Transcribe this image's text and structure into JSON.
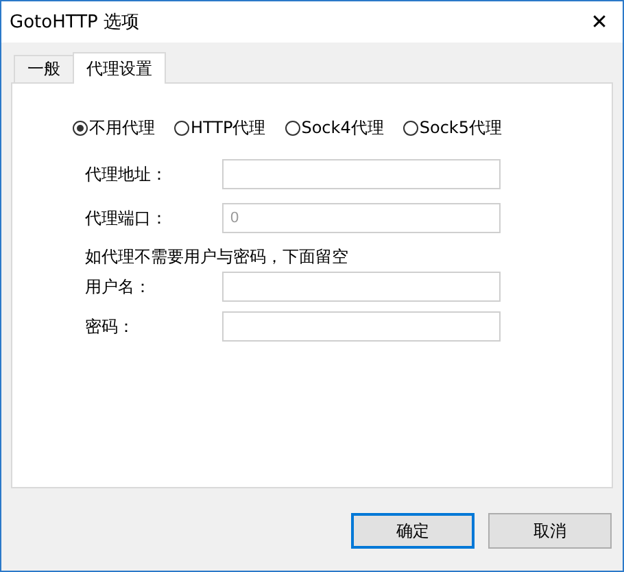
{
  "window": {
    "title": "GotoHTTP 选项",
    "close": "✕"
  },
  "tabs": [
    {
      "label": "一般",
      "selected": false
    },
    {
      "label": "代理设置",
      "selected": true
    }
  ],
  "proxy_types": [
    {
      "label": "不用代理",
      "selected": true
    },
    {
      "label": "HTTP代理",
      "selected": false
    },
    {
      "label": "Sock4代理",
      "selected": false
    },
    {
      "label": "Sock5代理",
      "selected": false
    }
  ],
  "server_fields": [
    {
      "label": "代理地址："
    },
    {
      "label": "代理端口：",
      "placeholder": "0"
    }
  ],
  "note": "如代理不需要用户与密码，下面留空",
  "auth_fields": [
    {
      "label": "用户名："
    },
    {
      "label": "密码："
    }
  ],
  "buttons": [
    {
      "label": "确定",
      "default": true
    },
    {
      "label": "取消",
      "default": false
    }
  ]
}
